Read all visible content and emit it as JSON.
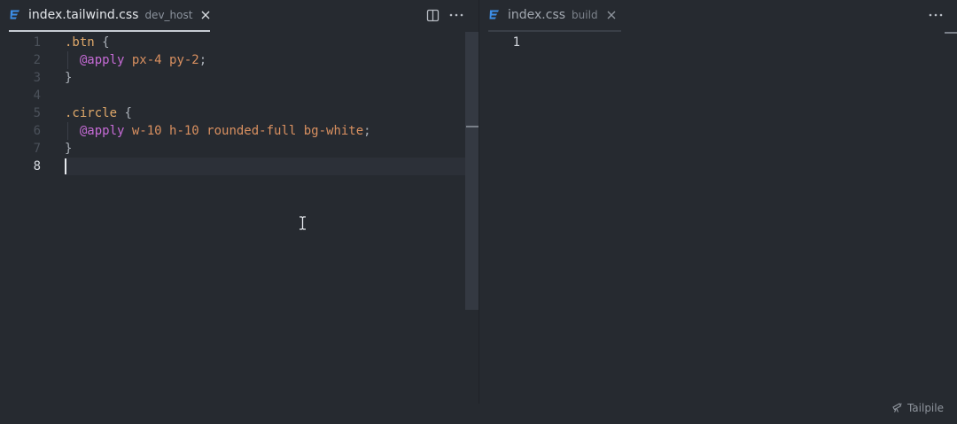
{
  "left_pane": {
    "tab": {
      "file_name": "index.tailwind.css",
      "description": "dev_host",
      "icon": "css-file-icon"
    },
    "code_lines": [
      [
        {
          "t": ".btn",
          "c": "sel"
        },
        {
          "t": " {",
          "c": "pn"
        }
      ],
      [
        {
          "t": "  ",
          "c": "pn"
        },
        {
          "t": "@apply",
          "c": "kw"
        },
        {
          "t": " px-4 py-2",
          "c": "cls"
        },
        {
          "t": ";",
          "c": "pn"
        }
      ],
      [
        {
          "t": "}",
          "c": "pn"
        }
      ],
      [],
      [
        {
          "t": ".circle",
          "c": "sel"
        },
        {
          "t": " {",
          "c": "pn"
        }
      ],
      [
        {
          "t": "  ",
          "c": "pn"
        },
        {
          "t": "@apply",
          "c": "kw"
        },
        {
          "t": " w-10 h-10 rounded-full bg-white",
          "c": "cls"
        },
        {
          "t": ";",
          "c": "pn"
        }
      ],
      [
        {
          "t": "}",
          "c": "pn"
        }
      ],
      []
    ],
    "line_numbers": [
      "1",
      "2",
      "3",
      "4",
      "5",
      "6",
      "7",
      "8"
    ],
    "active_line": 8
  },
  "right_pane": {
    "tab": {
      "file_name": "index.css",
      "description": "build",
      "icon": "css-file-icon"
    },
    "line_numbers": [
      "1"
    ]
  },
  "footer": {
    "brand": "Tailpile",
    "icon": "telescope-icon"
  },
  "colors": {
    "background": "#262a30",
    "selector": "#e0a96a",
    "keyword": "#c66bd6",
    "class": "#d99060",
    "css_icon": "#3d8fe8"
  }
}
